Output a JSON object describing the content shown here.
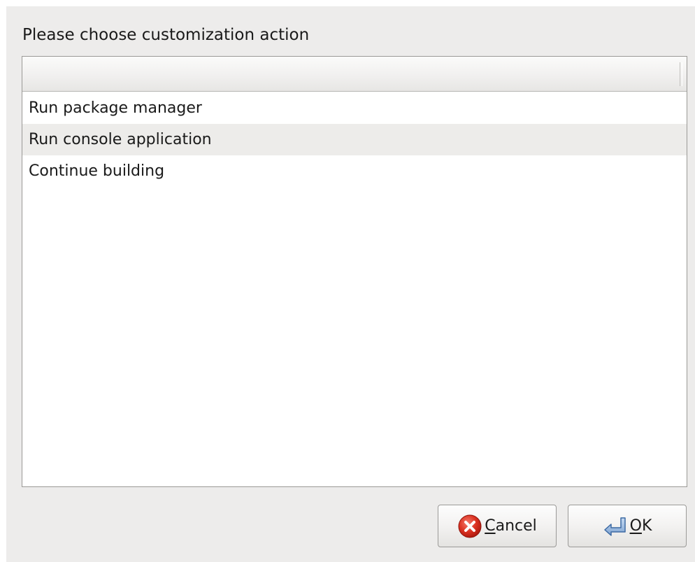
{
  "dialog": {
    "prompt": "Please choose customization action"
  },
  "list": {
    "header": "",
    "items": [
      {
        "label": "Run package manager"
      },
      {
        "label": "Run console application"
      },
      {
        "label": "Continue building"
      }
    ]
  },
  "buttons": {
    "cancel": {
      "mnemonic": "C",
      "rest": "ancel",
      "icon": "cancel-icon"
    },
    "ok": {
      "mnemonic": "O",
      "rest": "K",
      "icon": "ok-return-icon"
    }
  },
  "colors": {
    "window_bg": "#edeceb",
    "list_bg": "#ffffff",
    "alt_row_bg": "#edecea",
    "cancel_icon": "#d42a1c"
  }
}
